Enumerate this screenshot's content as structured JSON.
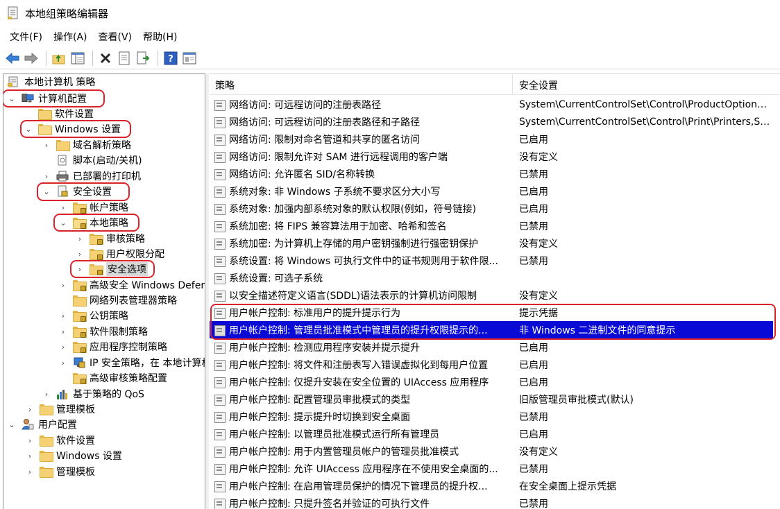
{
  "window": {
    "title": "本地组策略编辑器"
  },
  "menu": [
    "文件(F)",
    "操作(A)",
    "查看(V)",
    "帮助(H)"
  ],
  "toolbar": [
    "back-arrow-icon",
    "forward-arrow-icon",
    "up-folder-icon",
    "show-hide-tree-icon",
    "delete-icon",
    "properties-icon",
    "export-list-icon",
    "help-icon",
    "view-icon"
  ],
  "tree": {
    "items": [
      {
        "label": "本地计算机 策略",
        "icon": "computer-policy-icon",
        "chev": ""
      },
      {
        "label": "计算机配置",
        "icon": "computer-icon",
        "chev": "down"
      },
      {
        "label": "软件设置",
        "icon": "folder-icon",
        "chev": ""
      },
      {
        "label": "Windows 设置",
        "icon": "folder-icon",
        "chev": "down"
      },
      {
        "label": "域名解析策略",
        "icon": "folder-icon",
        "chev": "right"
      },
      {
        "label": "脚本(启动/关机)",
        "icon": "script-icon",
        "chev": ""
      },
      {
        "label": "已部署的打印机",
        "icon": "printer-icon",
        "chev": "right"
      },
      {
        "label": "安全设置",
        "icon": "security-icon",
        "chev": "down"
      },
      {
        "label": "帐户策略",
        "icon": "locked-folder-icon",
        "chev": "right"
      },
      {
        "label": "本地策略",
        "icon": "locked-folder-icon",
        "chev": "down"
      },
      {
        "label": "审核策略",
        "icon": "locked-folder-icon",
        "chev": "right"
      },
      {
        "label": "用户权限分配",
        "icon": "locked-folder-icon",
        "chev": "right"
      },
      {
        "label": "安全选项",
        "icon": "locked-folder-icon",
        "chev": "right"
      },
      {
        "label": "高级安全 Windows Defender 防火墙",
        "icon": "locked-folder-icon",
        "chev": "right"
      },
      {
        "label": "网络列表管理器策略",
        "icon": "folder-icon",
        "chev": ""
      },
      {
        "label": "公钥策略",
        "icon": "locked-folder-icon",
        "chev": "right"
      },
      {
        "label": "软件限制策略",
        "icon": "locked-folder-icon",
        "chev": "right"
      },
      {
        "label": "应用程序控制策略",
        "icon": "locked-folder-icon",
        "chev": "right"
      },
      {
        "label": "IP 安全策略，在 本地计算机",
        "icon": "ip-security-icon",
        "chev": "right"
      },
      {
        "label": "高级审核策略配置",
        "icon": "locked-folder-icon",
        "chev": "right"
      },
      {
        "label": "基于策略的 QoS",
        "icon": "qos-chart-icon",
        "chev": "right"
      },
      {
        "label": "管理模板",
        "icon": "folder-icon",
        "chev": "right"
      },
      {
        "label": "用户配置",
        "icon": "user-icon",
        "chev": "down"
      },
      {
        "label": "软件设置",
        "icon": "folder-icon",
        "chev": "right"
      },
      {
        "label": "Windows 设置",
        "icon": "folder-icon",
        "chev": "right"
      },
      {
        "label": "管理模板",
        "icon": "folder-icon",
        "chev": "right"
      }
    ]
  },
  "list": {
    "columns": [
      "策略",
      "安全设置"
    ],
    "rows": [
      {
        "policy": "网络访问: 可远程访问的注册表路径",
        "setting": "System\\CurrentControlSet\\Control\\ProductOptions,..."
      },
      {
        "policy": "网络访问: 可远程访问的注册表路径和子路径",
        "setting": "System\\CurrentControlSet\\Control\\Print\\Printers,Sys..."
      },
      {
        "policy": "网络访问: 限制对命名管道和共享的匿名访问",
        "setting": "已启用"
      },
      {
        "policy": "网络访问: 限制允许对 SAM 进行远程调用的客户端",
        "setting": "没有定义"
      },
      {
        "policy": "网络访问: 允许匿名 SID/名称转换",
        "setting": "已禁用"
      },
      {
        "policy": "系统对象: 非 Windows 子系统不要求区分大小写",
        "setting": "已启用"
      },
      {
        "policy": "系统对象: 加强内部系统对象的默认权限(例如，符号链接)",
        "setting": "已启用"
      },
      {
        "policy": "系统加密: 将 FIPS 兼容算法用于加密、哈希和签名",
        "setting": "已禁用"
      },
      {
        "policy": "系统加密: 为计算机上存储的用户密钥强制进行强密钥保护",
        "setting": "没有定义"
      },
      {
        "policy": "系统设置: 将 Windows 可执行文件中的证书规则用于软件限...",
        "setting": "已禁用"
      },
      {
        "policy": "系统设置: 可选子系统",
        "setting": ""
      },
      {
        "policy": "以安全描述符定义语言(SDDL)语法表示的计算机访问限制",
        "setting": "没有定义"
      },
      {
        "policy": "用户帐户控制: 标准用户的提升提示行为",
        "setting": "提示凭据"
      },
      {
        "policy": "用户帐户控制: 管理员批准模式中管理员的提升权限提示的...",
        "setting": "非 Windows 二进制文件的同意提示"
      },
      {
        "policy": "用户帐户控制: 检测应用程序安装并提示提升",
        "setting": "已启用"
      },
      {
        "policy": "用户帐户控制: 将文件和注册表写入错误虚拟化到每用户位置",
        "setting": "已启用"
      },
      {
        "policy": "用户帐户控制: 仅提升安装在安全位置的 UIAccess 应用程序",
        "setting": "已启用"
      },
      {
        "policy": "用户帐户控制:   配置管理员审批模式的类型",
        "setting": "旧版管理员审批模式(默认)"
      },
      {
        "policy": "用户帐户控制: 提示提升时切换到安全桌面",
        "setting": "已禁用"
      },
      {
        "policy": "用户帐户控制: 以管理员批准模式运行所有管理员",
        "setting": "已启用"
      },
      {
        "policy": "用户帐户控制: 用于内置管理员帐户的管理员批准模式",
        "setting": "没有定义"
      },
      {
        "policy": "用户帐户控制: 允许 UIAccess 应用程序在不使用安全桌面的...",
        "setting": "已禁用"
      },
      {
        "policy": "用户帐户控制: 在启用管理员保护的情况下管理员的提升权...",
        "setting": "在安全桌面上提示凭据"
      },
      {
        "policy": "用户帐户控制: 只提升签名并验证的可执行文件",
        "setting": "已禁用"
      }
    ]
  },
  "colors": {
    "selection": "#0a0ad6",
    "highlight_ring": "#d9222a"
  }
}
